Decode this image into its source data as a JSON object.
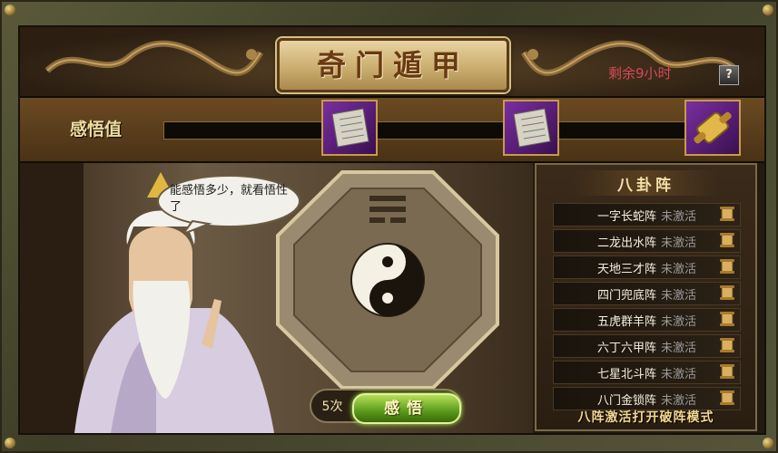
{
  "header": {
    "title": "奇门遁甲",
    "remaining_time": "剩余9小时",
    "help_label": "?"
  },
  "insight": {
    "label": "感悟值",
    "progress": 0.0,
    "rewards": [
      {
        "icon": "scroll-document-icon"
      },
      {
        "icon": "scroll-document-icon"
      },
      {
        "icon": "golden-scroll-icon"
      }
    ]
  },
  "scene": {
    "speech": "能感悟多少，就看悟性了",
    "count": "5次",
    "comprehend_label": "感悟"
  },
  "panel": {
    "title": "八卦阵",
    "formations": [
      {
        "name": "一字长蛇阵",
        "status": "未激活"
      },
      {
        "name": "二龙出水阵",
        "status": "未激活"
      },
      {
        "name": "天地三才阵",
        "status": "未激活"
      },
      {
        "name": "四门兜底阵",
        "status": "未激活"
      },
      {
        "name": "五虎群羊阵",
        "status": "未激活"
      },
      {
        "name": "六丁六甲阵",
        "status": "未激活"
      },
      {
        "name": "七星北斗阵",
        "status": "未激活"
      },
      {
        "name": "八门金锁阵",
        "status": "未激活"
      }
    ],
    "footer": "八阵激活打开破阵模式"
  },
  "colors": {
    "remaining_time": "#d8485a",
    "inactive_status": "#9a9a9a",
    "button_green": "#5a9a1a"
  }
}
